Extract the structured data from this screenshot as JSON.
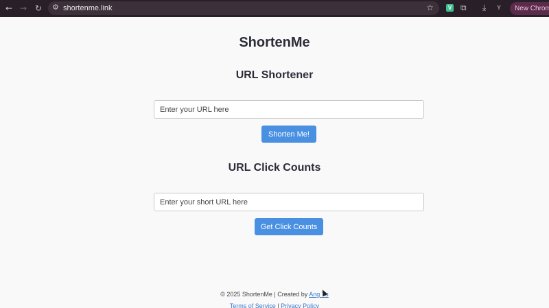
{
  "browser": {
    "url": "shortenme.link",
    "extension_badge": "V",
    "profile_initial": "Y",
    "new_chrome_label": "New Chrome a"
  },
  "app": {
    "title": "ShortenMe",
    "shortener": {
      "heading": "URL Shortener",
      "input_placeholder": "Enter your URL here",
      "button_label": "Shorten Me!"
    },
    "click_counts": {
      "heading": "URL Click Counts",
      "input_placeholder": "Enter your short URL here",
      "button_label": "Get Click Counts"
    }
  },
  "footer": {
    "copyright_prefix": "© 2025 ShortenMe | Created by ",
    "author_link": "Ang Tu",
    "terms_link": "Terms of Service",
    "separator": " | ",
    "privacy_link": "Privacy Policy"
  },
  "colors": {
    "accent": "#4a90e2",
    "browser_bar": "#291f28",
    "page_bg": "#f9f9f9"
  }
}
